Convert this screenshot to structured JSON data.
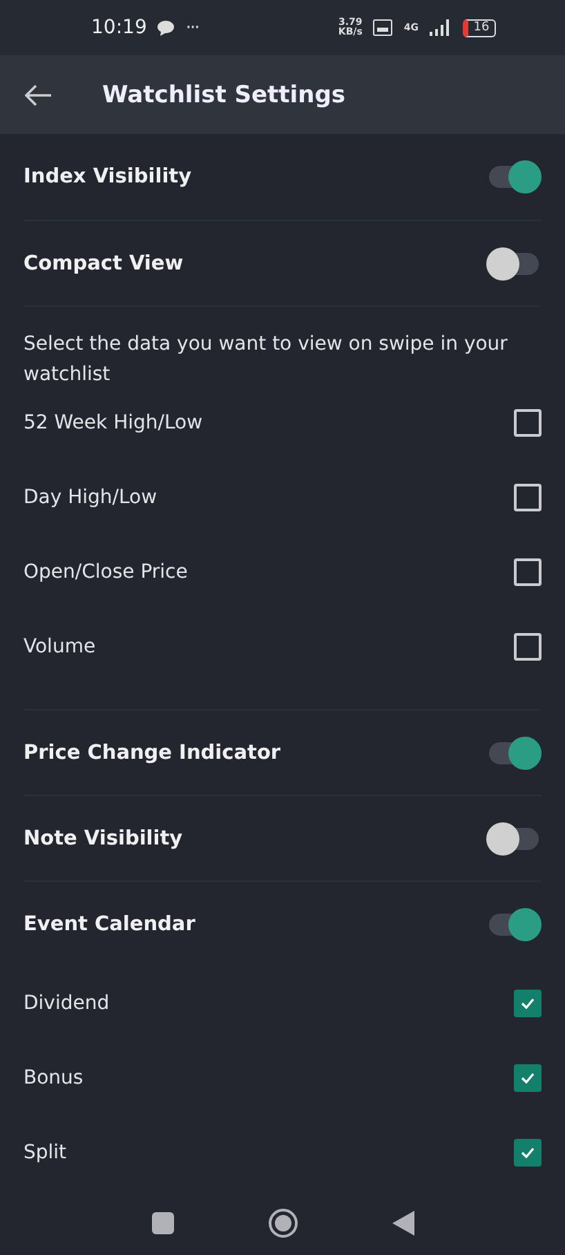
{
  "status_bar": {
    "time": "10:19",
    "more": "···",
    "speed_value": "3.79",
    "speed_unit": "KB/s",
    "network": "4G",
    "battery": "16"
  },
  "header": {
    "title": "Watchlist Settings"
  },
  "items": [
    {
      "kind": "toggle",
      "label": "Index Visibility",
      "on": true
    },
    {
      "kind": "toggle",
      "label": "Compact View",
      "on": false
    },
    {
      "kind": "text",
      "label": "Select the data you want to view on swipe in your watchlist"
    },
    {
      "kind": "checkbox",
      "label": "52 Week High/Low",
      "checked": false
    },
    {
      "kind": "checkbox",
      "label": "Day High/Low",
      "checked": false
    },
    {
      "kind": "checkbox",
      "label": "Open/Close Price",
      "checked": false
    },
    {
      "kind": "checkbox",
      "label": "Volume",
      "checked": false
    },
    {
      "kind": "toggle",
      "label": "Price Change Indicator",
      "on": true
    },
    {
      "kind": "toggle",
      "label": "Note Visibility",
      "on": false
    },
    {
      "kind": "toggle",
      "label": "Event Calendar",
      "on": true
    },
    {
      "kind": "checkbox",
      "label": "Dividend",
      "checked": true
    },
    {
      "kind": "checkbox",
      "label": "Bonus",
      "checked": true
    },
    {
      "kind": "checkbox",
      "label": "Split",
      "checked": true
    }
  ]
}
